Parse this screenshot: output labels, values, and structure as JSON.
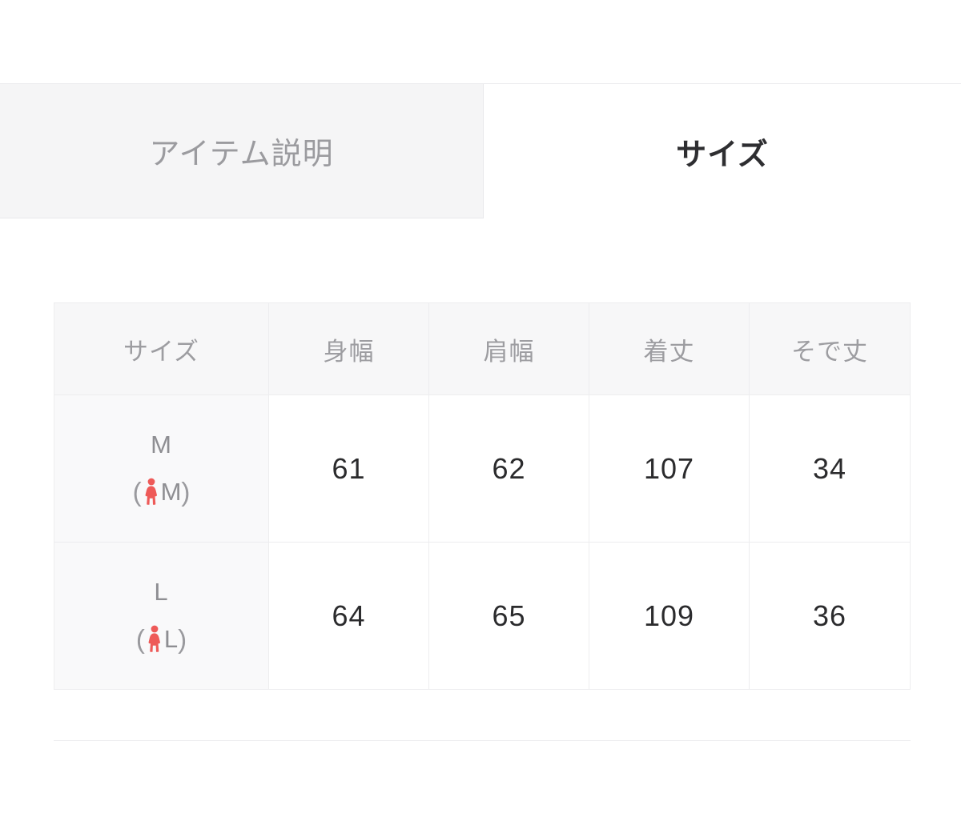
{
  "tabs": [
    {
      "label": "アイテム説明",
      "active": false,
      "name": "tab-item-description"
    },
    {
      "label": "サイズ",
      "active": true,
      "name": "tab-size"
    }
  ],
  "size_table": {
    "headers": [
      "サイズ",
      "身幅",
      "肩幅",
      "着丈",
      "そで丈"
    ],
    "rows": [
      {
        "size_letter": "M",
        "sub_open": "(",
        "sub_icon": "woman-figure-icon",
        "sub_letter": "M",
        "sub_close": ")",
        "values": [
          "61",
          "62",
          "107",
          "34"
        ]
      },
      {
        "size_letter": "L",
        "sub_open": "(",
        "sub_icon": "woman-figure-icon",
        "sub_letter": "L",
        "sub_close": ")",
        "values": [
          "64",
          "65",
          "109",
          "36"
        ]
      }
    ]
  },
  "colors": {
    "tab_active_text": "#2e2e31",
    "tab_inactive_text": "#9b9b9f",
    "tab_inactive_bg": "#f5f5f6",
    "table_header_bg": "#f7f7f8",
    "table_header_text": "#9d9da1",
    "size_cell_bg": "#f9f9fa",
    "value_text": "#2b2b2d",
    "woman_icon": "#ee5a58",
    "border": "#ededef"
  }
}
